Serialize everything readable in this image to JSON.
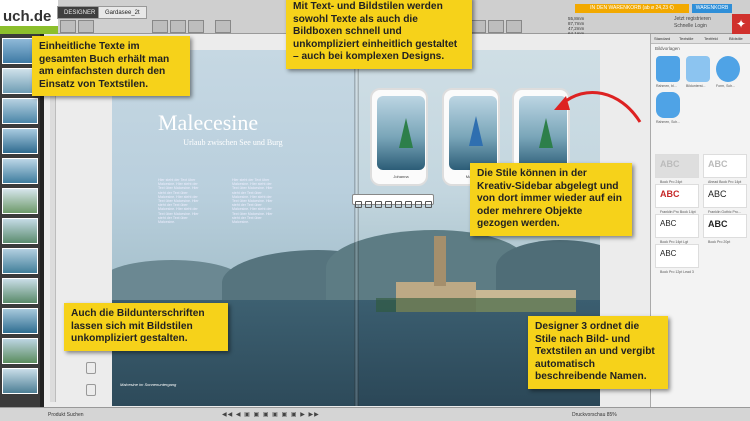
{
  "topbar": {
    "logo": "uch.de",
    "tabs": [
      "DESIGNER",
      "Gardasee_2t"
    ],
    "promo": "IN DEN WARENKORB (ab ø 24,23 €)",
    "ware": "WARENKORB",
    "cart_lines": [
      "Jetzt registrieren",
      "Schnelle Login"
    ],
    "coords": [
      "55,8mm",
      "87,7mm",
      "47,2mm",
      "64,1mm",
      "0°"
    ]
  },
  "page": {
    "title": "Malecesine",
    "subtitle": "Urlaub zwischen See und Burg",
    "body_text": "Hier steht der Text über Malcesine. Hier steht der Text über Malcesine. Hier steht der Text über Malcesine. Hier steht der Text über Malcesine. Hier steht der Text über Malcesine. Hier steht der Text über Malcesine. Hier steht der Text über Malcesine.",
    "left_caption": "Malcesine im Sonnenuntergang",
    "image_captions": [
      "Johanna",
      "Marlene",
      ""
    ]
  },
  "panel": {
    "tabs": [
      "Standard",
      "Textstile",
      "Textfeld",
      "Bildstile"
    ],
    "title": "Bildvorlagen",
    "swatch_labels": [
      "Rahmen, bl...",
      "Bildunterst...",
      "Form, Sch...",
      "Rahmen, Sch..."
    ],
    "text_styles": [
      {
        "label": "ABC",
        "name": "Book Pro 24pt"
      },
      {
        "label": "ABC",
        "name": "Ahead Book Pro 14pt"
      },
      {
        "label": "ABC",
        "name": "Franklin Pro Book 14pt"
      },
      {
        "label": "ABC",
        "name": "Franklin Gothic Pro..."
      },
      {
        "label": "ABC",
        "name": "Book Pro 14pt Lgt"
      },
      {
        "label": "ABC",
        "name": "Book Pro 20pt"
      },
      {
        "label": "ABC",
        "name": "Book Pro 12pt Lead 3"
      }
    ]
  },
  "bottombar": {
    "left": "Produkt   Suchen",
    "right": "Druckvorschau      85%"
  },
  "callouts": {
    "c1": "Einheitliche Texte im gesamten Buch erhält man am einfachsten durch den Einsatz von Textstilen.",
    "c2": "Mit Text- und Bildstilen werden sowohl Texte als auch die Bildboxen schnell und unkompliziert einheitlich gestaltet – auch bei komplexen Designs.",
    "c3": "Die Stile können in der Kreativ-Sidebar abgelegt und von dort immer wieder auf ein oder mehrere Objekte gezogen werden.",
    "c4": "Auch die Bildunterschriften lassen sich mit Bildstilen unkompliziert gestalten.",
    "c5": "Designer 3 ordnet die Stile nach Bild- und Textstilen an und vergibt automatisch beschreibende Namen."
  }
}
